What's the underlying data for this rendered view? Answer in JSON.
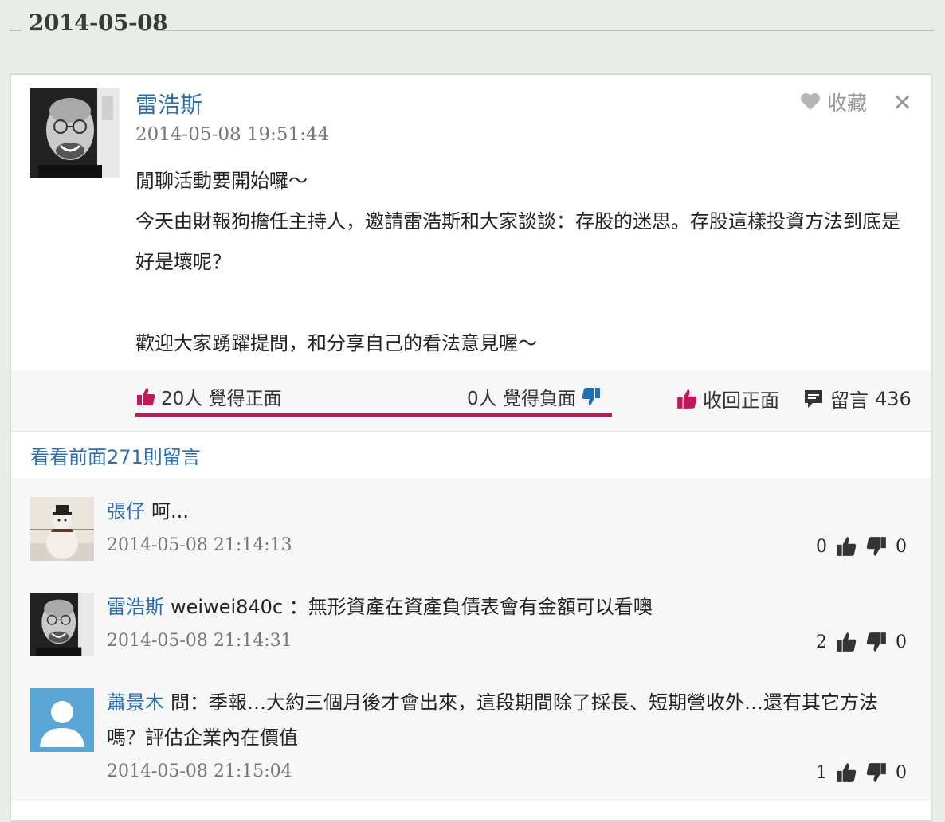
{
  "date_header": "2014-05-08",
  "post": {
    "author": "雷浩斯",
    "timestamp": "2014-05-08 19:51:44",
    "favorite_label": "收藏",
    "close_symbol": "✕",
    "body": [
      "閒聊活動要開始囉～",
      "今天由財報狗擔任主持人，邀請雷浩斯和大家談談：存股的迷思。存股這樣投資方法到底是好是壞呢？",
      "",
      "歡迎大家踴躍提問，和分享自己的看法意見喔～"
    ]
  },
  "reactions": {
    "positive_label": "20人 覺得正面",
    "negative_label": "0人 覺得負面",
    "positive_ratio": 1.0,
    "withdraw_label": "收回正面",
    "comments_label": "留言",
    "comments_count": "436",
    "accent_color": "#c2185b",
    "negative_color": "#1f6fb8"
  },
  "see_previous": "看看前面271則留言",
  "comments": [
    {
      "name": "張仔",
      "text": "呵...",
      "time": "2014-05-08 21:14:13",
      "up": "0",
      "down": "0",
      "avatar_icon": "snowman-avatar"
    },
    {
      "name": "雷浩斯",
      "text": "weiwei840c ：無形資產在資產負債表會有金額可以看噢",
      "time": "2014-05-08 21:14:31",
      "up": "2",
      "down": "0",
      "avatar_icon": "user-photo-avatar"
    },
    {
      "name": "蕭景木",
      "text": "問：季報…大約三個月後才會出來，這段期間除了採長、短期營收外…還有其它方法嗎？評估企業內在價值",
      "time": "2014-05-08 21:15:04",
      "up": "1",
      "down": "0",
      "avatar_icon": "default-user-avatar"
    }
  ]
}
